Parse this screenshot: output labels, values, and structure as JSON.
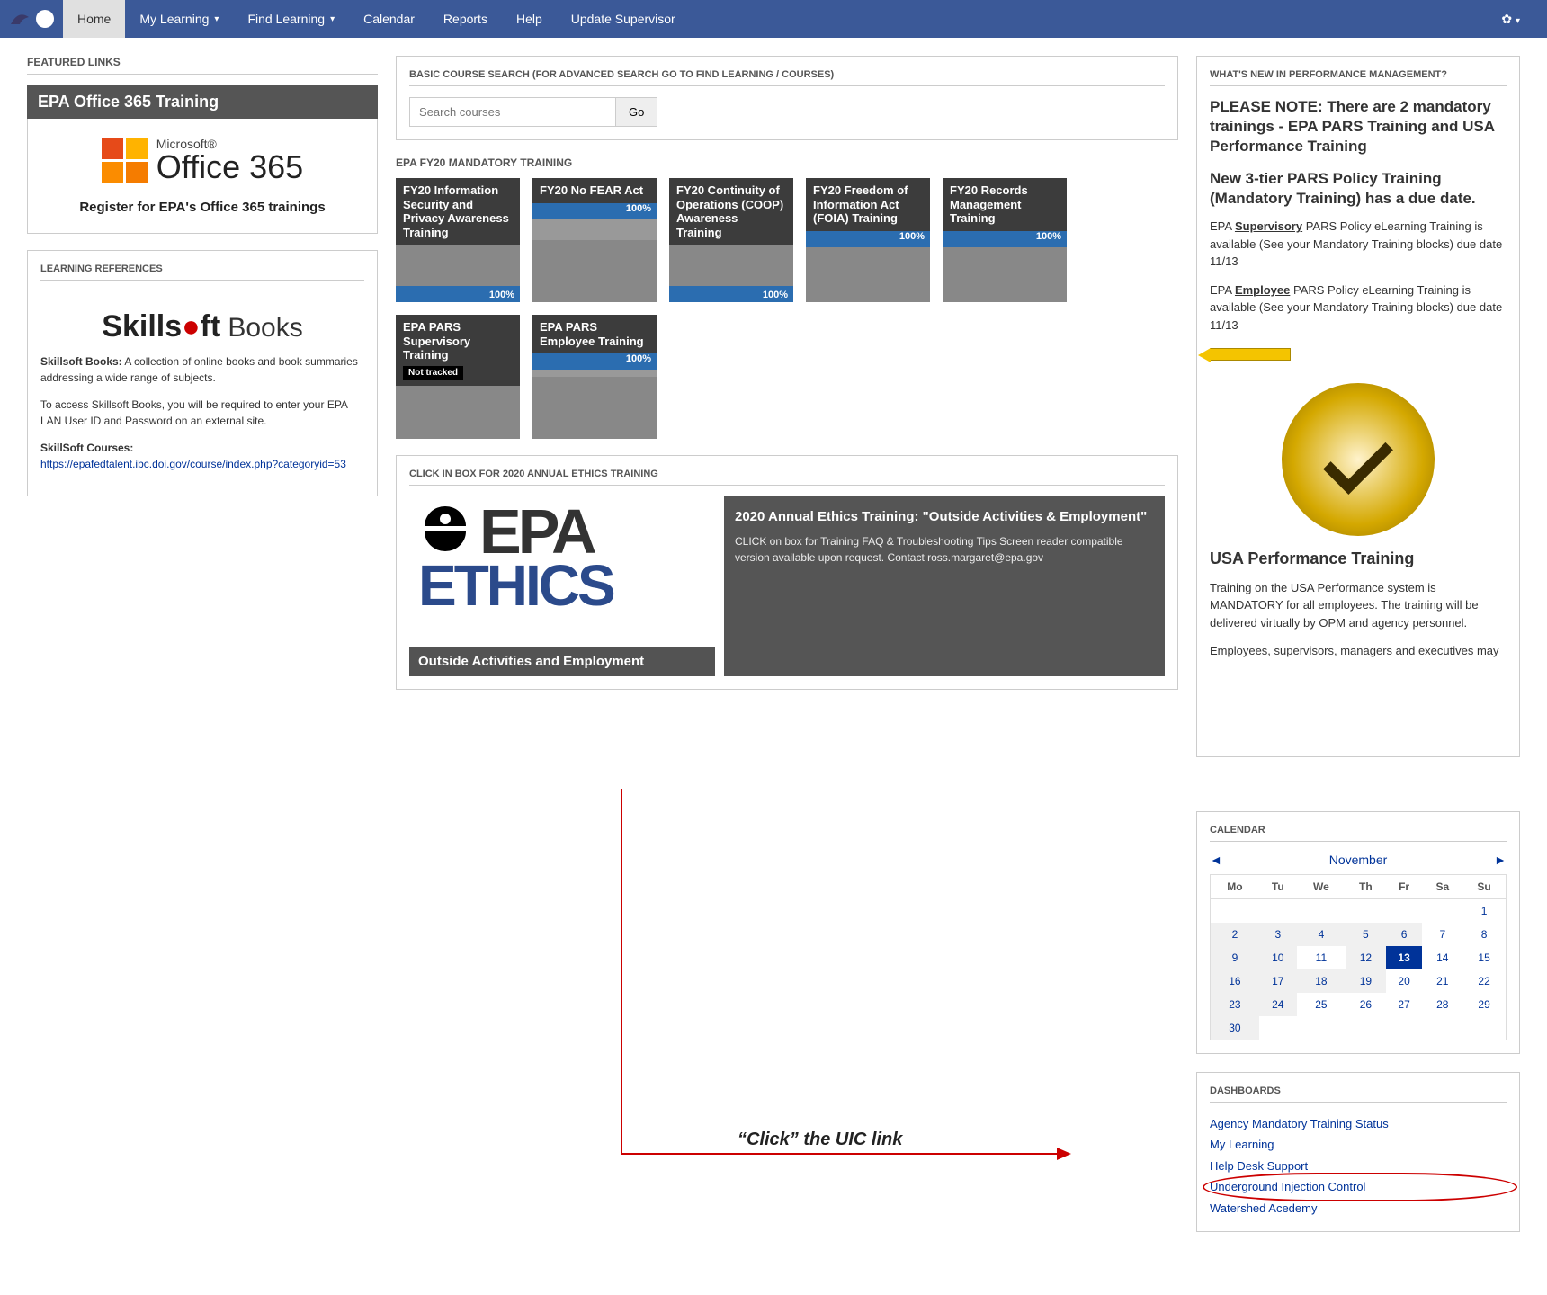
{
  "nav": {
    "items": [
      {
        "label": "Home",
        "active": true,
        "chev": false
      },
      {
        "label": "My Learning",
        "active": false,
        "chev": true
      },
      {
        "label": "Find Learning",
        "active": false,
        "chev": true
      },
      {
        "label": "Calendar",
        "active": false,
        "chev": false
      },
      {
        "label": "Reports",
        "active": false,
        "chev": false
      },
      {
        "label": "Help",
        "active": false,
        "chev": false
      },
      {
        "label": "Update Supervisor",
        "active": false,
        "chev": false
      }
    ]
  },
  "featured": {
    "title": "FEATURED LINKS",
    "banner": "EPA Office 365 Training",
    "ms": "Microsoft®",
    "o365": "Office 365",
    "tagline": "Register for EPA's Office 365 trainings"
  },
  "refs": {
    "title": "LEARNING REFERENCES",
    "logo1": "Skills",
    "logo2": "ft",
    "books": "Books",
    "p1a": "Skillsoft Books:",
    "p1b": " A collection of online books and book summaries addressing a wide range of subjects.",
    "p2": "To access Skillsoft Books, you will be required to enter your EPA LAN User ID and Password on an external site.",
    "p3a": "SkillSoft Courses:",
    "p3b": "https://epafedtalent.ibc.doi.gov/course/index.php?categoryid=53"
  },
  "search": {
    "title": "BASIC COURSE SEARCH (FOR ADVANCED SEARCH GO TO FIND LEARNING / COURSES)",
    "placeholder": "Search courses",
    "go": "Go"
  },
  "mandatory": {
    "title": "EPA FY20 MANDATORY TRAINING",
    "tiles": [
      {
        "label": "FY20 Information Security and Privacy Awareness Training",
        "pct": "100%",
        "tracked": true,
        "pos": "bottom"
      },
      {
        "label": "FY20 No FEAR Act",
        "pct": "100%",
        "tracked": true,
        "pos": "head"
      },
      {
        "label": "FY20 Continuity of Operations (COOP) Awareness Training",
        "pct": "100%",
        "tracked": true,
        "pos": "bottom"
      },
      {
        "label": "FY20 Freedom of Information Act (FOIA) Training",
        "pct": "100%",
        "tracked": true,
        "pos": "head"
      },
      {
        "label": "FY20 Records Management Training",
        "pct": "100%",
        "tracked": true,
        "pos": "head"
      },
      {
        "label": "EPA PARS Supervisory Training",
        "pct": "",
        "tracked": false,
        "badge": "Not tracked",
        "pos": "head"
      },
      {
        "label": "EPA PARS Employee Training",
        "pct": "100%",
        "tracked": true,
        "pos": "head"
      }
    ]
  },
  "ethics": {
    "title": "CLICK IN BOX FOR 2020 ANNUAL ETHICS TRAINING",
    "epa": "EPA",
    "ethics": "ETHICS",
    "bar": "Outside Activities and Employment",
    "side_hd": "2020 Annual Ethics Training: \"Outside Activities & Employment\"",
    "side_body": "CLICK on box for Training FAQ & Troubleshooting Tips Screen reader compatible version available upon request. Contact ross.margaret@epa.gov"
  },
  "right": {
    "title": "WHAT'S NEW IN PERFORMANCE MANAGEMENT?",
    "note": "PLEASE NOTE: There are 2 mandatory trainings - EPA PARS Training and USA Performance Training",
    "tier": "New 3-tier PARS Policy Training (Mandatory Training) has a due date.",
    "sup1": "EPA ",
    "sup2": "Supervisory",
    "sup3": " PARS Policy eLearning Training is available (See your Mandatory Training blocks) due date 11/13",
    "emp1": "EPA ",
    "emp2": "Employee",
    "emp3": " PARS Policy eLearning Training is available (See your Mandatory Training blocks) due date 11/13",
    "usa_hd": "USA Performance Training",
    "usa1": "Training on the USA Performance system is MANDATORY for all employees. The training will be delivered virtually by OPM and agency personnel.",
    "usa2": "Employees, supervisors, managers and executives may register for one of the three trainings below"
  },
  "calendar": {
    "title": "CALENDAR",
    "month": "November",
    "days": [
      "Mo",
      "Tu",
      "We",
      "Th",
      "Fr",
      "Sa",
      "Su"
    ],
    "weeks": [
      [
        {
          "n": "",
          "t": "blank"
        },
        {
          "n": "",
          "t": "blank"
        },
        {
          "n": "",
          "t": "blank"
        },
        {
          "n": "",
          "t": "blank"
        },
        {
          "n": "",
          "t": "blank"
        },
        {
          "n": "",
          "t": "blank"
        },
        {
          "n": "1",
          "t": "norm"
        }
      ],
      [
        {
          "n": "2",
          "t": "shade"
        },
        {
          "n": "3",
          "t": "shade"
        },
        {
          "n": "4",
          "t": "shade"
        },
        {
          "n": "5",
          "t": "shade"
        },
        {
          "n": "6",
          "t": "shade"
        },
        {
          "n": "7",
          "t": "norm"
        },
        {
          "n": "8",
          "t": "norm"
        }
      ],
      [
        {
          "n": "9",
          "t": "shade"
        },
        {
          "n": "10",
          "t": "shade"
        },
        {
          "n": "11",
          "t": "norm"
        },
        {
          "n": "12",
          "t": "shade"
        },
        {
          "n": "13",
          "t": "today"
        },
        {
          "n": "14",
          "t": "norm"
        },
        {
          "n": "15",
          "t": "norm"
        }
      ],
      [
        {
          "n": "16",
          "t": "shade"
        },
        {
          "n": "17",
          "t": "shade"
        },
        {
          "n": "18",
          "t": "shade"
        },
        {
          "n": "19",
          "t": "shade"
        },
        {
          "n": "20",
          "t": "norm"
        },
        {
          "n": "21",
          "t": "norm"
        },
        {
          "n": "22",
          "t": "norm"
        }
      ],
      [
        {
          "n": "23",
          "t": "shade"
        },
        {
          "n": "24",
          "t": "shade"
        },
        {
          "n": "25",
          "t": "norm"
        },
        {
          "n": "26",
          "t": "norm"
        },
        {
          "n": "27",
          "t": "norm"
        },
        {
          "n": "28",
          "t": "norm"
        },
        {
          "n": "29",
          "t": "norm"
        }
      ],
      [
        {
          "n": "30",
          "t": "shade"
        },
        {
          "n": "",
          "t": "blank"
        },
        {
          "n": "",
          "t": "blank"
        },
        {
          "n": "",
          "t": "blank"
        },
        {
          "n": "",
          "t": "blank"
        },
        {
          "n": "",
          "t": "blank"
        },
        {
          "n": "",
          "t": "blank"
        }
      ]
    ]
  },
  "dash": {
    "title": "DASHBOARDS",
    "links": [
      "Agency Mandatory Training Status",
      "My Learning",
      "Help Desk Support",
      "Underground Injection Control",
      "Watershed Acedemy"
    ]
  },
  "callout": "“Click” the UIC link"
}
